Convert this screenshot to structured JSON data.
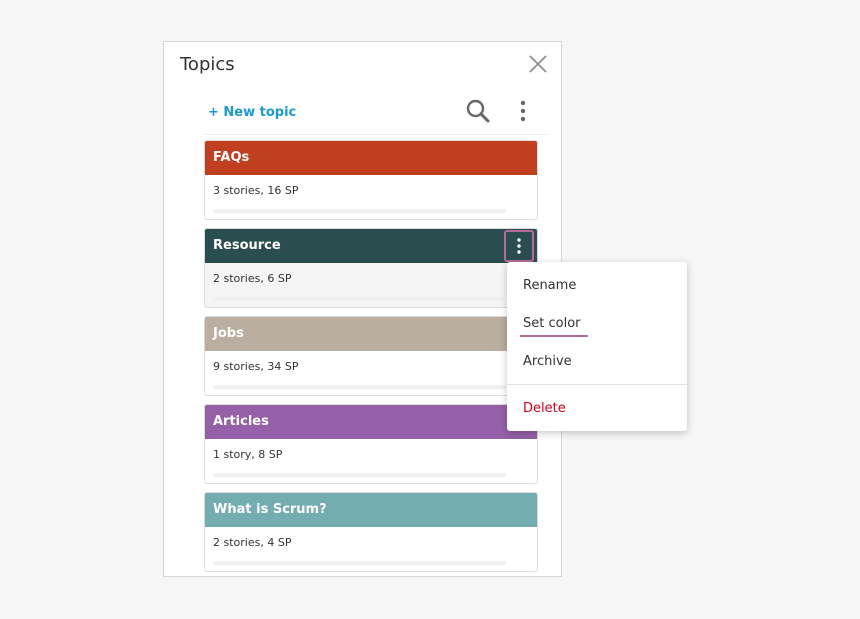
{
  "panel": {
    "title": "Topics",
    "close_icon": "close-icon"
  },
  "toolbar": {
    "new_topic_label": "+ New topic",
    "search_icon": "search-icon",
    "more_icon": "more-vertical-icon"
  },
  "topics": [
    {
      "name": "FAQs",
      "meta": "3 stories, 16 SP",
      "color": "#bf3f1f"
    },
    {
      "name": "Resource",
      "meta": "2 stories, 6 SP",
      "color": "#2a4e50"
    },
    {
      "name": "Jobs",
      "meta": "9 stories, 34 SP",
      "color": "#baaea0"
    },
    {
      "name": "Articles",
      "meta": "1 story, 8 SP",
      "color": "#9560a8"
    },
    {
      "name": "What is Scrum?",
      "meta": "2 stories, 4 SP",
      "color": "#74adb1"
    }
  ],
  "context_menu": {
    "items": {
      "rename": "Rename",
      "set_color": "Set color",
      "archive": "Archive",
      "delete": "Delete"
    },
    "delete_color": "#d0021b",
    "highlight_color": "#b86a99"
  }
}
